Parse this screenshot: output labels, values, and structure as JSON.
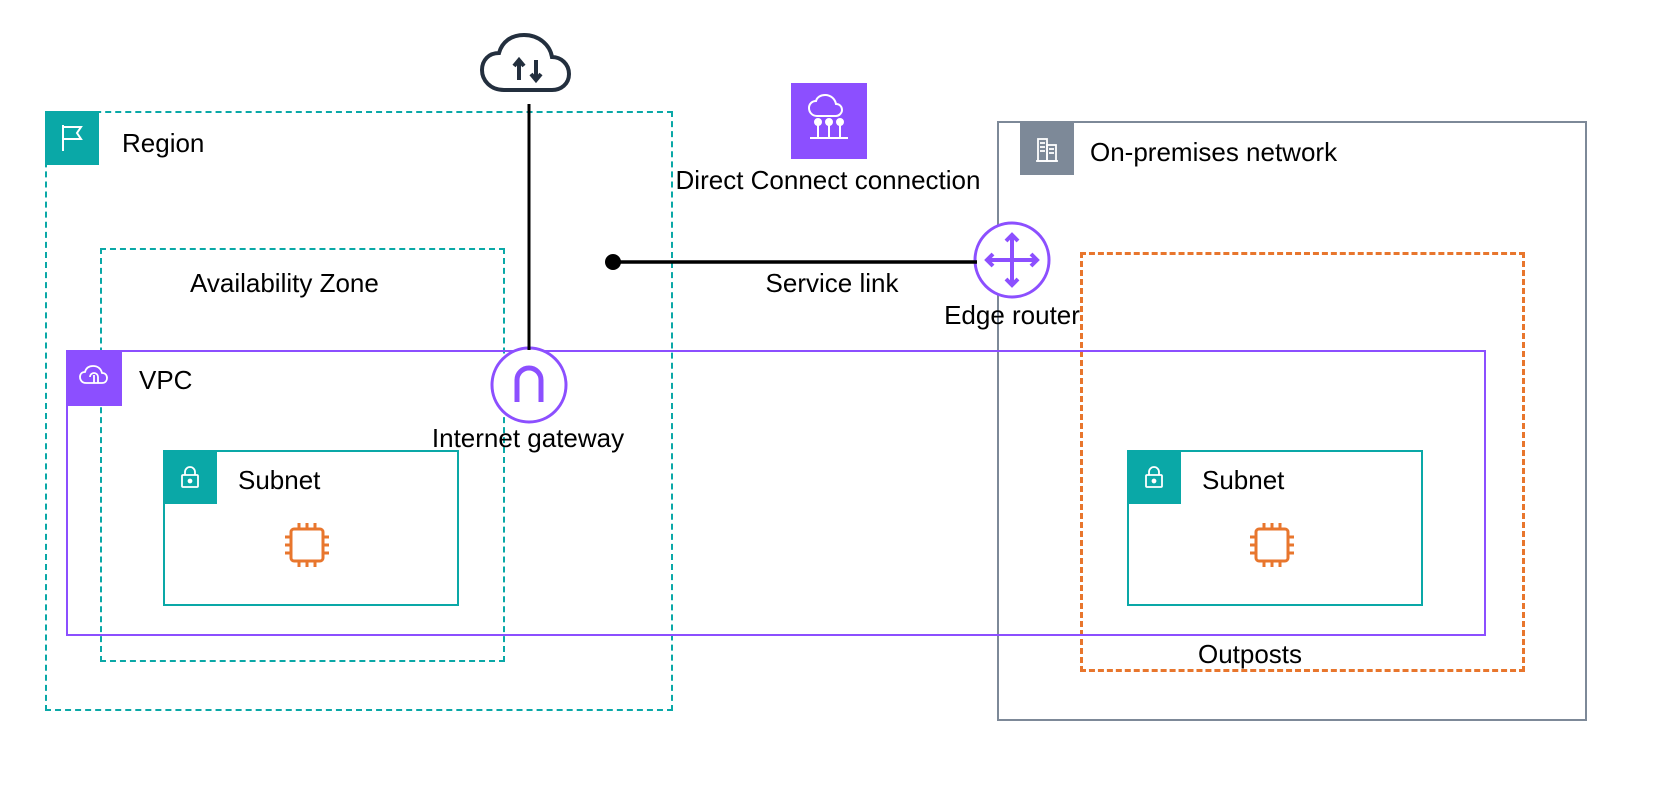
{
  "diagram": {
    "region_label": "Region",
    "az_label": "Availability Zone",
    "vpc_label": "VPC",
    "subnet_label_left": "Subnet",
    "subnet_label_right": "Subnet",
    "onprem_label": "On-premises network",
    "outposts_label": "Outposts",
    "internet_gateway_label": "Internet gateway",
    "edge_router_label": "Edge router",
    "service_link_label": "Service link",
    "direct_connect_label": "Direct Connect connection"
  },
  "colors": {
    "teal": "#0AA8A7",
    "purple": "#8C4FFF",
    "orange": "#E8762D",
    "gray": "#7D8998",
    "darknavy": "#232F3E"
  }
}
